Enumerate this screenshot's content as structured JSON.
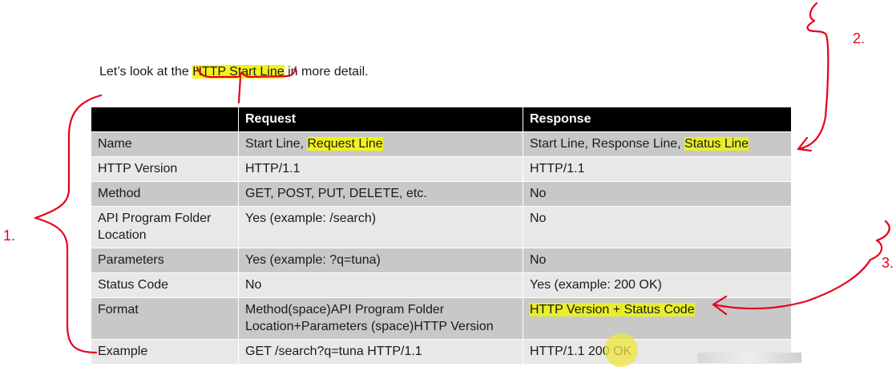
{
  "intro": {
    "before": "Let’s look at the ",
    "highlight": "HTTP Start Line",
    "after": " in more detail."
  },
  "table": {
    "headers": [
      "",
      "Request",
      "Response"
    ],
    "rows": [
      {
        "label": "Name",
        "request_plain": "Start Line, ",
        "request_hl": "Request Line",
        "response_plain": "Start Line, Response Line, ",
        "response_hl": "Status Line"
      },
      {
        "label": "HTTP Version",
        "request": "HTTP/1.1",
        "response": "HTTP/1.1"
      },
      {
        "label": "Method",
        "request": "GET, POST, PUT, DELETE, etc.",
        "response": "No"
      },
      {
        "label": "API Program Folder Location",
        "request": "Yes (example: /search)",
        "response": "No"
      },
      {
        "label": "Parameters",
        "request": "Yes (example: ?q=tuna)",
        "response": "No"
      },
      {
        "label": "Status Code",
        "request": "No",
        "response": "Yes (example: 200 OK)"
      },
      {
        "label": "Format",
        "request": "Method(space)API Program Folder Location+Parameters (space)HTTP Version",
        "response_hl": "HTTP Version + Status Code"
      },
      {
        "label": "Example",
        "request": "GET /search?q=tuna HTTP/1.1",
        "response": "HTTP/1.1 200 OK"
      }
    ]
  },
  "annotations": {
    "marks": [
      "1.",
      "2.",
      "3."
    ],
    "ink_color": "#e8001c",
    "highlight_color": "#f2f21a"
  }
}
